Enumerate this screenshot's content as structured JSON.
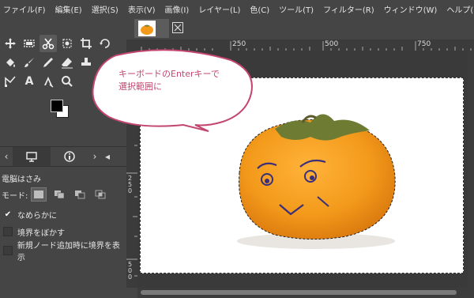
{
  "menubar": {
    "items": [
      "ファイル(F)",
      "編集(E)",
      "選択(S)",
      "表示(V)",
      "画像(I)",
      "レイヤー(L)",
      "色(C)",
      "ツール(T)",
      "フィルター(R)",
      "ウィンドウ(W)",
      "ヘルプ(H)"
    ]
  },
  "toolbox": {
    "text_tool_glyph": "A"
  },
  "tool_options": {
    "title": "電脳はさみ",
    "mode_label": "モード:",
    "options": [
      {
        "label": "なめらかに",
        "checked": true
      },
      {
        "label": "境界をぼかす",
        "checked": false
      },
      {
        "label": "新規ノード追加時に境界を表示",
        "checked": false
      }
    ]
  },
  "canvas": {
    "ruler_top_labels": [
      "250",
      "500",
      "750"
    ],
    "ruler_left_labels": [
      "2",
      "5",
      "0",
      "5",
      "0",
      "0"
    ]
  },
  "callout": {
    "line1": "キーボードのEnterキーで",
    "line2": "選択範囲に"
  },
  "colors": {
    "callout_border": "#c2466e",
    "callout_text": "#c2466e",
    "persimmon": "#f39a1b"
  }
}
